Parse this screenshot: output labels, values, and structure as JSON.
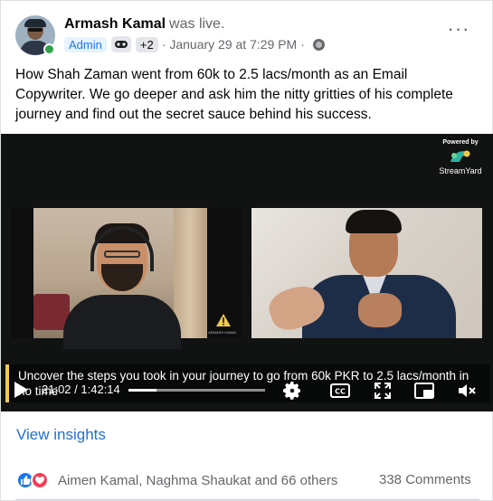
{
  "post": {
    "author": "Armash Kamal",
    "status": "was live.",
    "role": "Admin",
    "extra_badges": "+2",
    "separator": "·",
    "timestamp": "January 29 at 7:29 PM",
    "text": "How Shah Zaman went from 60k to 2.5 lacs/month as an Email Copywriter. We go deeper and ask him the nitty gritties of his complete journey and find out the secret sauce behind his success."
  },
  "video": {
    "powered_by": "Powered by",
    "brand": "StreamYard",
    "watermark": "ARMASH KAMAL",
    "caption": "Uncover the steps you took in your journey to go from 60k PKR to 2.5 lacs/month in no time",
    "current_time": "21:02",
    "total_time": "1:42:14",
    "time_separator": " / ",
    "progress_fraction": 0.2055
  },
  "footer": {
    "insights": "View insights",
    "reactors": "Aimen Kamal, Naghma Shaukat and 66 others",
    "comments": "338 Comments"
  },
  "icons": {
    "more": "more-horizontal-icon",
    "globe": "globe-icon",
    "play": "play-icon",
    "settings": "gear-icon",
    "captions": "closed-captions-icon",
    "fullscreen": "expand-icon",
    "pip": "picture-in-picture-icon",
    "volume": "volume-muted-icon",
    "like": "like-icon",
    "love": "love-icon"
  },
  "colors": {
    "link": "#216fdb",
    "accent": "#1877f2",
    "online": "#31a24c",
    "caption_bar": "#f2c94c",
    "love": "#f33e58"
  }
}
